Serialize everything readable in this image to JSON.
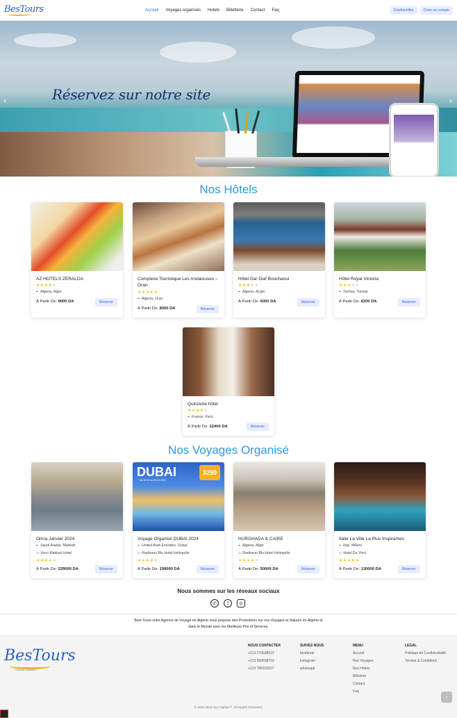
{
  "nav": {
    "logo": "BesTours",
    "menu": [
      "Accueil",
      "Voyages organisés",
      "Hotels",
      "Billetterie",
      "Contact",
      "Faq"
    ],
    "login": "S'authentifier",
    "signup": "Créer un compte"
  },
  "hero": {
    "title": "Réservez sur notre site",
    "prev": "‹",
    "next": "›"
  },
  "hotels_title": "Nos Hôtels",
  "hotels": [
    {
      "name": "AZ HOTELS ZERALDA",
      "stars": 4,
      "location": "Algeria, Alger",
      "price_label": "À Partir De:",
      "price": "9000 DA",
      "btn": "Réserver"
    },
    {
      "name": "Complexe Touristique Les Andalouses – Oran",
      "stars": 5,
      "location": "Algeria, Oran",
      "price_label": "À Partir De:",
      "price": "8000 DA",
      "btn": "Réserver"
    },
    {
      "name": "Hôtel Dar Diaf Bouchaoui",
      "stars": 3,
      "location": "Algeria, ALger",
      "price_label": "À Partir De:",
      "price": "6000 DA",
      "btn": "Réserver"
    },
    {
      "name": "Hôtel Royal Victoria",
      "stars": 3,
      "location": "Tunisia, Tunisia",
      "price_label": "À Partir De:",
      "price": "8200 DA",
      "btn": "Réserver"
    },
    {
      "name": "Quinzerie hôtel",
      "stars": 4,
      "location": "France, Paris",
      "price_label": "À Partir De:",
      "price": "22400 DA",
      "btn": "Réserver"
    }
  ],
  "trips_title": "Nos Voyages Organisé",
  "trips": [
    {
      "name": "Omra Janvier 2024",
      "location": "Saudi Arabia, Makkah",
      "hotel": "Voco Makkah Hotel",
      "stars": 4,
      "price_label": "À Partir De:",
      "price": "229000 DA",
      "btn": "Réserver"
    },
    {
      "name": "Voyage Organisé DUBAI 2024",
      "location": "United Arab Emirates, Dubai",
      "hotel": "Radisson Blu Hotel Heliopolis",
      "stars": 4,
      "price_label": "À Partir De:",
      "price": "199000 DA",
      "btn": "Réserver",
      "poster_title": "DUBAI",
      "poster_price": "3290",
      "poster_dates": "Du 30-10 au 08-11-2023"
    },
    {
      "name": "HURGHADA & CAIRE",
      "location": "Algeria, Alger",
      "hotel": "Radisson Blu Hotel Heliopolis",
      "stars": 4,
      "price_label": "À Partir De:",
      "price": "50000 DA",
      "btn": "Réserver"
    },
    {
      "name": "Italie La Ville La Plus Inspirantes",
      "location": "Italy, Milano",
      "hotel": "Hotel De Vinci",
      "stars": 5,
      "price_label": "À Partir De:",
      "price": "130000 DA",
      "btn": "Réserver"
    }
  ],
  "social": {
    "title": "Nous sommes sur les réseaux sociaux",
    "icons": [
      "whatsapp-icon",
      "facebook-icon",
      "instagram-icon"
    ]
  },
  "about": "Best Tours votre Agence de Voyage en Algérie vous propose des Promotions sur vos Voyages et Séjours en Algérie et dans le Monde avec les Meilleurs Prix et Services.",
  "footer": {
    "logo": "BesTours",
    "tagline": "TRAVEL AGENCY",
    "contact": {
      "title": "NOUS CONTACTER",
      "items": [
        "+213 770638523",
        "+213 550638753",
        "+213 780110527"
      ]
    },
    "follow": {
      "title": "SUIVEZ-NOUS",
      "items": [
        "facebook",
        "instagram",
        "whatsapp"
      ]
    },
    "menu": {
      "title": "MENU",
      "items": [
        "Accueil",
        "Nos Voyages",
        "Nos Hôtels",
        "Billeterie",
        "Contact",
        "Faq"
      ]
    },
    "legal": {
      "title": "LEGAL",
      "items": [
        "Politique de Confidentialité",
        "Termes & Conditions"
      ]
    },
    "copyright": "© 2024 Best tour Algérie™. All Rights Reserved.",
    "totop": "↑"
  },
  "colors": {
    "accent": "#2b9be0",
    "link": "#2f6fd6",
    "button_bg": "#e7edff",
    "star": "#f3c10b"
  }
}
